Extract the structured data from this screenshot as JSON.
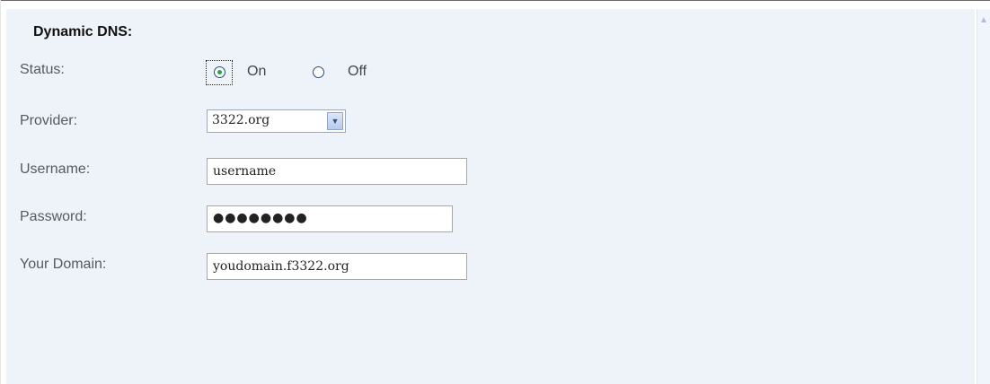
{
  "section_title": "Dynamic DNS:",
  "status": {
    "label": "Status:",
    "options": [
      {
        "label": "On",
        "selected": true
      },
      {
        "label": "Off",
        "selected": false
      }
    ]
  },
  "provider": {
    "label": "Provider:",
    "value": "3322.org"
  },
  "username": {
    "label": "Username:",
    "value": "username"
  },
  "password": {
    "label": "Password:",
    "value": "●●●●●●●●"
  },
  "domain": {
    "label": "Your Domain:",
    "value": "youdomain.f3322.org"
  },
  "icons": {
    "dropdown": "chevron-down-icon",
    "scroll_up": "scroll-up-arrow-icon"
  },
  "colors": {
    "panel_background": "#eef3fa",
    "radio_selected": "#2aa14a",
    "label_text": "#555a62"
  }
}
